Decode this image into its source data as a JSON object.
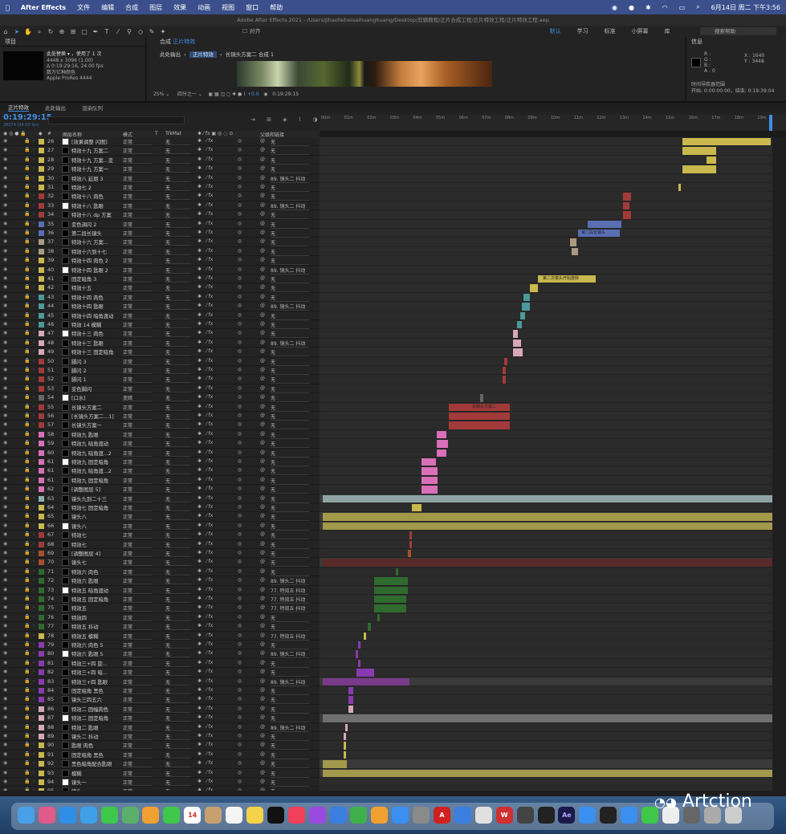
{
  "menubar": {
    "apple": "",
    "app": "After Effects",
    "items": [
      "文件",
      "编辑",
      "合成",
      "图层",
      "效果",
      "动画",
      "视图",
      "窗口",
      "帮助"
    ],
    "clock": "6月14日 周二 下午3:56"
  },
  "titlebar": "Adobe After Effects 2021 - /Users/jihaofeiheisaihuanghuang/Desktop/剪辑教程/正片合成工程/正片特效工程/正片特效工程.aep",
  "toolbar": {
    "align_label": "对齐",
    "workspaces": [
      "默认",
      "学习",
      "标准",
      "小屏幕",
      "库"
    ],
    "active_workspace": "默认",
    "search_placeholder": "搜索帮助"
  },
  "project": {
    "title": "项目",
    "item_name": "此处替换 ▾ ，使用了 1 次",
    "meta": [
      "4448 x 3096 (1.00)",
      "Δ 0:19:29:16, 24.00 fps",
      "数万亿种颜色",
      "Apple ProRes 4444"
    ]
  },
  "comp": {
    "panel_title": "合成",
    "tab": "正片特效",
    "crumbs": [
      "此处输出",
      "正片特效",
      "长镜头方案二 合成 1"
    ],
    "zoom": "25%",
    "resolution": "四分之一",
    "exposure": "+0.0",
    "time": "0:19:29:15"
  },
  "info": {
    "title": "信息",
    "r": "R :",
    "g": "G :",
    "b": "B :",
    "a": "A : 0",
    "x": "X : 1640",
    "y": "Y : 3448",
    "nav_label": "时间导航器范围",
    "nav_range": "开始: 0:00:00:00，结束: 0:19:39:04"
  },
  "timeline": {
    "tabs": [
      "正片特效",
      "此处输出",
      "渲染队列"
    ],
    "active_tab": "正片特效",
    "timecode": "0:19:29:15",
    "fps": "28074 (24.00 fps)",
    "cols": {
      "num": "#",
      "name": "图层名称",
      "mode": "模式",
      "t": "T",
      "trkmat": "TrkMat",
      "parent": "父级和链接"
    },
    "ruler": [
      "00m",
      "01m",
      "02m",
      "03m",
      "04m",
      "05m",
      "06m",
      "07m",
      "08m",
      "09m",
      "10m",
      "11m",
      "12m",
      "13m",
      "14m",
      "15m",
      "16m",
      "17m",
      "18m",
      "19m"
    ]
  },
  "layers": [
    {
      "n": "26",
      "name": "[效果调整 闪图]",
      "mode": "正常",
      "trk": "无",
      "par": "无",
      "color": "#c9b84d"
    },
    {
      "n": "27",
      "name": "特效十九 方案二",
      "mode": "正常",
      "trk": "无",
      "par": "无",
      "color": "#c9b84d"
    },
    {
      "n": "28",
      "name": "特效十九 方案...变",
      "mode": "正常",
      "trk": "无",
      "par": "无",
      "color": "#c9b84d"
    },
    {
      "n": "29",
      "name": "特效十九 方案一",
      "mode": "正常",
      "trk": "无",
      "par": "无",
      "color": "#c9b84d"
    },
    {
      "n": "30",
      "name": "特效八 延期 3",
      "mode": "正常",
      "trk": "无",
      "par": "89. 镜头二 抖动",
      "color": "#c9b84d"
    },
    {
      "n": "31",
      "name": "特效七 2",
      "mode": "正常",
      "trk": "无",
      "par": "无",
      "color": "#c9b84d"
    },
    {
      "n": "32",
      "name": "特效十八 肉色",
      "mode": "正常",
      "trk": "无",
      "par": "无",
      "color": "#a33a3a"
    },
    {
      "n": "33",
      "name": "特效十八 匙眼",
      "mode": "正常",
      "trk": "无",
      "par": "89. 镜头二 抖动",
      "color": "#a33a3a"
    },
    {
      "n": "34",
      "name": "特效十八 dp 方案",
      "mode": "正常",
      "trk": "无",
      "par": "无",
      "color": "#a33a3a"
    },
    {
      "n": "35",
      "name": "变色调闪 2",
      "mode": "正常",
      "trk": "无",
      "par": "无",
      "color": "#5a6fb3"
    },
    {
      "n": "36",
      "name": "第二段长镜头",
      "mode": "正常",
      "trk": "无",
      "par": "无",
      "color": "#5a6fb3"
    },
    {
      "n": "37",
      "name": "特效十六 方案...",
      "mode": "正常",
      "trk": "无",
      "par": "无",
      "color": "#a89b82"
    },
    {
      "n": "38",
      "name": "特效十六到十七",
      "mode": "正常",
      "trk": "无",
      "par": "无",
      "color": "#a89b82"
    },
    {
      "n": "39",
      "name": "特效十四 肉色 2",
      "mode": "正常",
      "trk": "无",
      "par": "无",
      "color": "#c9b84d"
    },
    {
      "n": "40",
      "name": "特效十四 匙眼 2",
      "mode": "正常",
      "trk": "无",
      "par": "89. 镜头二 抖动",
      "color": "#c9b84d"
    },
    {
      "n": "41",
      "name": "固定暗角 3",
      "mode": "正常",
      "trk": "无",
      "par": "无",
      "color": "#c9b84d"
    },
    {
      "n": "42",
      "name": "特效十五",
      "mode": "正常",
      "trk": "无",
      "par": "无",
      "color": "#c9b84d"
    },
    {
      "n": "43",
      "name": "特效十四 肉色",
      "mode": "正常",
      "trk": "无",
      "par": "无",
      "color": "#4a9a9a"
    },
    {
      "n": "44",
      "name": "特效十四 匙眼",
      "mode": "正常",
      "trk": "无",
      "par": "89. 镜头二 抖动",
      "color": "#4a9a9a"
    },
    {
      "n": "45",
      "name": "特效十四 暗角渡动",
      "mode": "正常",
      "trk": "无",
      "par": "无",
      "color": "#4a9a9a"
    },
    {
      "n": "46",
      "name": "特效 14 模糊",
      "mode": "正常",
      "trk": "无",
      "par": "无",
      "color": "#4a9a9a"
    },
    {
      "n": "47",
      "name": "特效十三 肉色",
      "mode": "正常",
      "trk": "无",
      "par": "无",
      "color": "#d8a8b8"
    },
    {
      "n": "48",
      "name": "特效十三 匙眼",
      "mode": "正常",
      "trk": "无",
      "par": "89. 镜头二 抖动",
      "color": "#d8a8b8"
    },
    {
      "n": "49",
      "name": "特效十三 固定暗角",
      "mode": "正常",
      "trk": "无",
      "par": "无",
      "color": "#d8a8b8"
    },
    {
      "n": "50",
      "name": "脚闪 3",
      "mode": "正常",
      "trk": "无",
      "par": "无",
      "color": "#a33a3a"
    },
    {
      "n": "51",
      "name": "脚闪 2",
      "mode": "正常",
      "trk": "无",
      "par": "无",
      "color": "#a33a3a"
    },
    {
      "n": "52",
      "name": "脚闪 1",
      "mode": "正常",
      "trk": "无",
      "par": "无",
      "color": "#a33a3a"
    },
    {
      "n": "53",
      "name": "变色脚闪",
      "mode": "正常",
      "trk": "无",
      "par": "无",
      "color": "#a33a3a"
    },
    {
      "n": "54",
      "name": "[口水]",
      "mode": "变暗",
      "trk": "无",
      "par": "无",
      "color": "#666666"
    },
    {
      "n": "55",
      "name": "长镜头方案二",
      "mode": "正常",
      "trk": "无",
      "par": "无",
      "color": "#a33a3a"
    },
    {
      "n": "56",
      "name": "[长镜头方案二...1]",
      "mode": "正常",
      "trk": "无",
      "par": "无",
      "color": "#a33a3a"
    },
    {
      "n": "57",
      "name": "长镜头方案一",
      "mode": "正常",
      "trk": "无",
      "par": "无",
      "color": "#a33a3a"
    },
    {
      "n": "58",
      "name": "特效九 匙眼",
      "mode": "正常",
      "trk": "无",
      "par": "无",
      "color": "#d86fb8"
    },
    {
      "n": "59",
      "name": "特效九 暗角渡动",
      "mode": "正常",
      "trk": "无",
      "par": "无",
      "color": "#d86fb8"
    },
    {
      "n": "60",
      "name": "特效九 暗角渡...2",
      "mode": "正常",
      "trk": "无",
      "par": "无",
      "color": "#d86fb8"
    },
    {
      "n": "61",
      "name": "特效九 固定暗角",
      "mode": "正常",
      "trk": "无",
      "par": "无",
      "color": "#d86fb8"
    },
    {
      "n": "61",
      "name": "特效九 暗角渡...2",
      "mode": "正常",
      "trk": "无",
      "par": "无",
      "color": "#d86fb8"
    },
    {
      "n": "61",
      "name": "特效九 固定暗角",
      "mode": "正常",
      "trk": "无",
      "par": "无",
      "color": "#d86fb8"
    },
    {
      "n": "62",
      "name": "[调整图层 5]",
      "mode": "正常",
      "trk": "无",
      "par": "无",
      "color": "#d86fb8"
    },
    {
      "n": "63",
      "name": "镜头九到二十三",
      "mode": "正常",
      "trk": "无",
      "par": "无",
      "color": "#8fb0b0"
    },
    {
      "n": "64",
      "name": "特效七 固定暗角",
      "mode": "正常",
      "trk": "无",
      "par": "无",
      "color": "#c9b84d"
    },
    {
      "n": "65",
      "name": "镜头八",
      "mode": "正常",
      "trk": "无",
      "par": "无",
      "color": "#c9b84d"
    },
    {
      "n": "66",
      "name": "镜头八",
      "mode": "正常",
      "trk": "无",
      "par": "无",
      "color": "#c9b84d"
    },
    {
      "n": "67",
      "name": "特效七",
      "mode": "正常",
      "trk": "无",
      "par": "无",
      "color": "#a33a3a"
    },
    {
      "n": "68",
      "name": "特效七",
      "mode": "正常",
      "trk": "无",
      "par": "无",
      "color": "#a33a3a"
    },
    {
      "n": "69",
      "name": "[调整图层 4]",
      "mode": "正常",
      "trk": "无",
      "par": "无",
      "color": "#a84f2c"
    },
    {
      "n": "70",
      "name": "镜头七",
      "mode": "正常",
      "trk": "无",
      "par": "无",
      "color": "#a84f2c"
    },
    {
      "n": "71",
      "name": "特效六 肉色",
      "mode": "正常",
      "trk": "无",
      "par": "无",
      "color": "#2f6b2f"
    },
    {
      "n": "72",
      "name": "特效六 匙眼",
      "mode": "正常",
      "trk": "无",
      "par": "89. 镜头二 抖动",
      "color": "#2f6b2f"
    },
    {
      "n": "73",
      "name": "特效五 暗角渡动",
      "mode": "正常",
      "trk": "无",
      "par": "77. 特效五 抖动",
      "color": "#2f6b2f"
    },
    {
      "n": "74",
      "name": "特效五 固定暗角",
      "mode": "正常",
      "trk": "无",
      "par": "77. 特效五 抖动",
      "color": "#2f6b2f"
    },
    {
      "n": "75",
      "name": "特效五",
      "mode": "正常",
      "trk": "无",
      "par": "77. 特效五 抖动",
      "color": "#2f6b2f"
    },
    {
      "n": "76",
      "name": "特效四",
      "mode": "正常",
      "trk": "无",
      "par": "无",
      "color": "#2f6b2f"
    },
    {
      "n": "77",
      "name": "特效五 抖动",
      "mode": "正常",
      "trk": "无",
      "par": "无",
      "color": "#2f6b2f"
    },
    {
      "n": "78",
      "name": "特效五 模糊",
      "mode": "正常",
      "trk": "无",
      "par": "77. 特效五 抖动",
      "color": "#c9b84d"
    },
    {
      "n": "79",
      "name": "特效六 肉色 5",
      "mode": "正常",
      "trk": "无",
      "par": "无",
      "color": "#8a3ab0"
    },
    {
      "n": "80",
      "name": "特效六 匙眼 5",
      "mode": "正常",
      "trk": "无",
      "par": "89. 镜头二 抖动",
      "color": "#8a3ab0"
    },
    {
      "n": "81",
      "name": "特效三+四 旋...",
      "mode": "正常",
      "trk": "无",
      "par": "无",
      "color": "#8a3ab0"
    },
    {
      "n": "82",
      "name": "特效三+四 暗...",
      "mode": "正常",
      "trk": "无",
      "par": "无",
      "color": "#8a3ab0"
    },
    {
      "n": "83",
      "name": "特效三+四 匙眼",
      "mode": "正常",
      "trk": "无",
      "par": "89. 镜头二 抖动",
      "color": "#8a3ab0"
    },
    {
      "n": "84",
      "name": "固定暗角 黑色",
      "mode": "正常",
      "trk": "无",
      "par": "无",
      "color": "#8a3ab0"
    },
    {
      "n": "85",
      "name": "镜头三四五六",
      "mode": "正常",
      "trk": "无",
      "par": "无",
      "color": "#8a3ab0"
    },
    {
      "n": "86",
      "name": "特效二 固幅肉色",
      "mode": "正常",
      "trk": "无",
      "par": "无",
      "color": "#d8a8b8"
    },
    {
      "n": "87",
      "name": "特效二 固定暗角",
      "mode": "正常",
      "trk": "无",
      "par": "无",
      "color": "#d8a8b8"
    },
    {
      "n": "88",
      "name": "特效二 匙眼",
      "mode": "正常",
      "trk": "无",
      "par": "89. 镜头二 抖动",
      "color": "#d8a8b8"
    },
    {
      "n": "89",
      "name": "镜头二 抖动",
      "mode": "正常",
      "trk": "无",
      "par": "无",
      "color": "#d8a8b8"
    },
    {
      "n": "90",
      "name": "匙眼 肉色",
      "mode": "正常",
      "trk": "无",
      "par": "无",
      "color": "#c9b84d"
    },
    {
      "n": "91",
      "name": "固定暗角 黑色",
      "mode": "正常",
      "trk": "无",
      "par": "无",
      "color": "#c9b84d"
    },
    {
      "n": "92",
      "name": "黑色暗角配合匙眼",
      "mode": "正常",
      "trk": "无",
      "par": "无",
      "color": "#c9b84d"
    },
    {
      "n": "93",
      "name": "模糊",
      "mode": "正常",
      "trk": "无",
      "par": "无",
      "color": "#c9b84d"
    },
    {
      "n": "94",
      "name": "镜头一",
      "mode": "正常",
      "trk": "无",
      "par": "无",
      "color": "#c9b84d"
    },
    {
      "n": "95",
      "name": "镜头一",
      "mode": "正常",
      "trk": "无",
      "par": "无",
      "color": "#c9b84d"
    }
  ],
  "clip_labels": [
    "第二段长镜头",
    "第二次镜头开始旋转",
    "长镜头方案二"
  ],
  "dock": {
    "calendar_day": "14",
    "ae_label": "Ae",
    "w_label": "W",
    "a_label": "A"
  },
  "watermark": "Artction"
}
